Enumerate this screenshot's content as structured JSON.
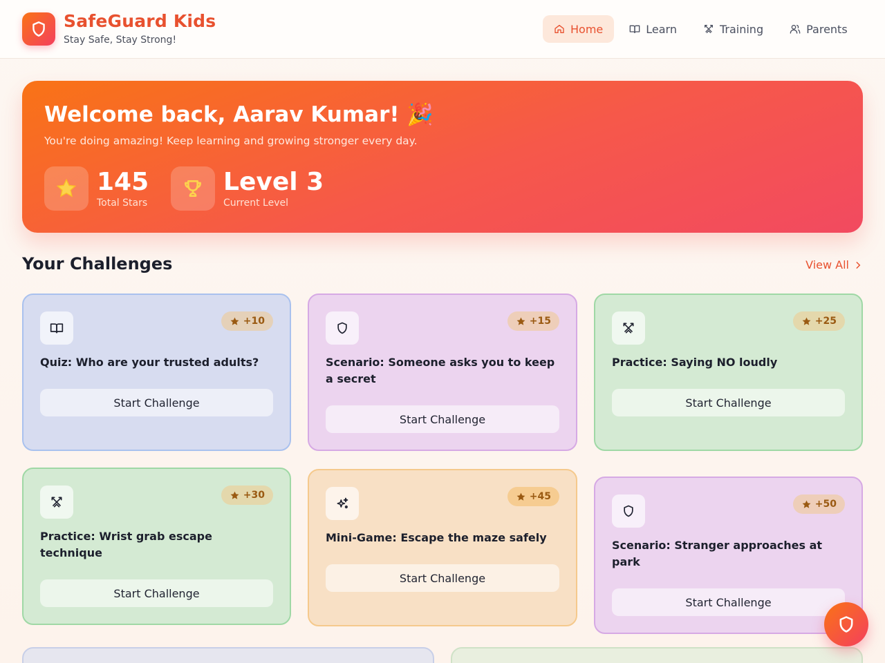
{
  "app": {
    "name": "SafeGuard Kids",
    "tagline": "Stay Safe, Stay Strong!"
  },
  "nav": [
    {
      "label": "Home",
      "icon": "home-icon",
      "active": true
    },
    {
      "label": "Learn",
      "icon": "book-icon",
      "active": false
    },
    {
      "label": "Training",
      "icon": "swords-icon",
      "active": false
    },
    {
      "label": "Parents",
      "icon": "users-icon",
      "active": false
    }
  ],
  "hero": {
    "title": "Welcome back, Aarav Kumar! 🎉",
    "subtitle": "You're doing amazing! Keep learning and growing stronger every day.",
    "stars_value": "145",
    "stars_label": "Total Stars",
    "level_value": "Level 3",
    "level_label": "Current Level"
  },
  "challenges": {
    "title": "Your Challenges",
    "view_all": "View All",
    "button_label": "Start Challenge",
    "items": [
      {
        "title": "Quiz: Who are your trusted adults?",
        "points": "+10",
        "icon": "book-icon",
        "color": "blue"
      },
      {
        "title": "Scenario: Someone asks you to keep a secret",
        "points": "+15",
        "icon": "shield-icon",
        "color": "purple"
      },
      {
        "title": "Practice: Saying NO loudly",
        "points": "+25",
        "icon": "swords-icon",
        "color": "green"
      },
      {
        "title": "Practice: Wrist grab escape technique",
        "points": "+30",
        "icon": "swords-icon",
        "color": "green"
      },
      {
        "title": "Mini-Game: Escape the maze safely",
        "points": "+45",
        "icon": "sparkles-icon",
        "color": "orange"
      },
      {
        "title": "Scenario: Stranger approaches at park",
        "points": "+50",
        "icon": "shield-icon",
        "color": "purple"
      }
    ]
  },
  "colors": {
    "accent": "#e8512f",
    "hero_start": "#f97316",
    "hero_end": "#f24a60"
  }
}
